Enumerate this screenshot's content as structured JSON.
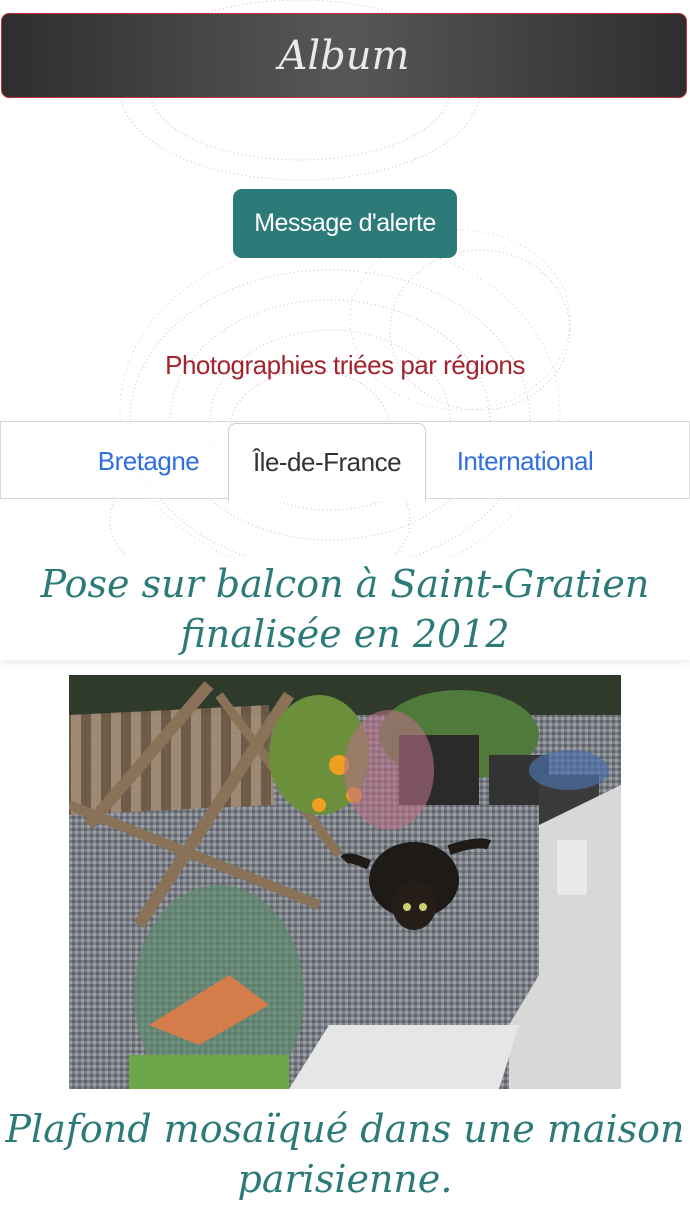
{
  "header": {
    "title": "Album"
  },
  "alert_button": {
    "label": "Message d'alerte"
  },
  "subtitle": "Photographies triées par régions",
  "tabs": [
    {
      "label": "Bretagne",
      "active": false
    },
    {
      "label": "Île-de-France",
      "active": true
    },
    {
      "label": "International",
      "active": false
    }
  ],
  "sections": [
    {
      "title": "Pose sur balcon à Saint-Gratien finalisée en 2012"
    },
    {
      "title": "Plafond mosaïqué dans une maison parisienne."
    }
  ],
  "colors": {
    "accent": "#2c7b78",
    "subtitle": "#a3242f",
    "link": "#2f6fe0",
    "header_border": "#c9313f"
  }
}
